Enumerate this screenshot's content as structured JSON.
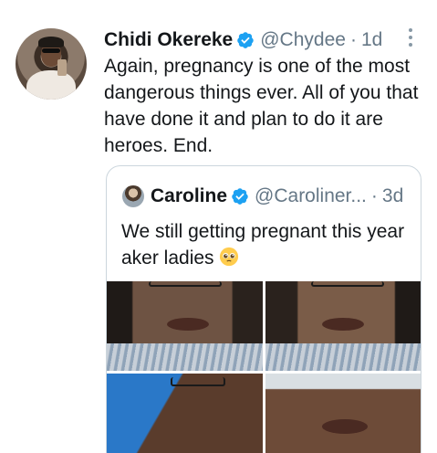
{
  "tweet": {
    "author_name": "Chidi Okereke",
    "handle": "@Chydee",
    "separator": "·",
    "time": "1d",
    "text": "Again, pregnancy is one of the most dangerous things ever. All of you that have done it and plan to do it are heroes. End."
  },
  "quoted": {
    "author_name": "Caroline",
    "handle": "@Caroliner...",
    "separator": "·",
    "time": "3d",
    "text": "We still getting pregnant this year aker ladies"
  },
  "icons": {
    "verified": "verified-badge-icon",
    "menu": "more-vertical-icon",
    "emoji": "pleading-face-emoji"
  },
  "colors": {
    "verified": "#1da1f2",
    "muted": "#657786",
    "border": "#ccd6dd"
  }
}
